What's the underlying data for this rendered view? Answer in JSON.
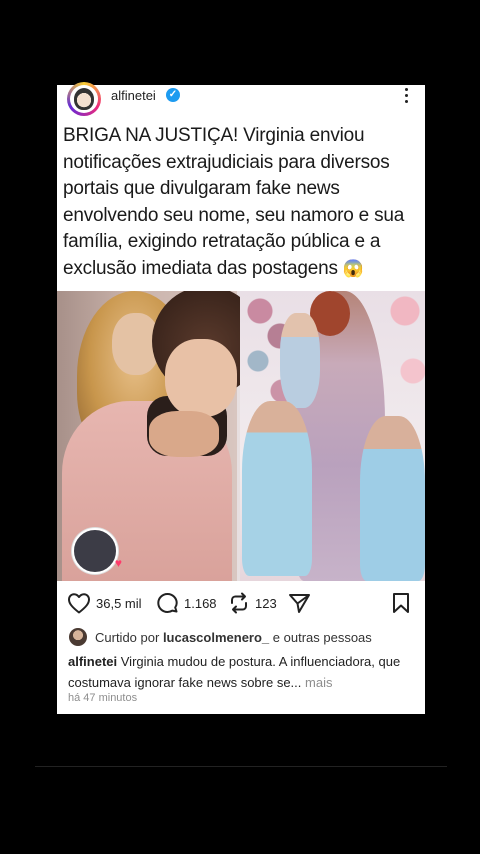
{
  "post": {
    "username": "alfinetei",
    "verified_mark": "✓",
    "headline_text": "BRIGA NA JUSTIÇA! Virginia enviou notificações extrajudiciais para diversos portais que divulgaram fake news envolvendo seu nome, seu namoro e sua família, exigindo retratação pública e a exclusão imediata das postagens",
    "headline_emoji": "😱",
    "actions": {
      "likes": "36,5 mil",
      "comments": "1.168",
      "reposts": "123"
    },
    "liked_by": {
      "prefix": "Curtido por",
      "user": "lucascolmenero_",
      "suffix": "e outras pessoas"
    },
    "caption": {
      "user": "alfinetei",
      "text": "Virginia mudou de postura. A influenciadora, que costumava ignorar fake news sobre se...",
      "more": "mais"
    },
    "time": "há 47 minutos"
  },
  "icons": {
    "like": "heart-icon",
    "comment": "comment-icon",
    "repost": "repost-icon",
    "share": "send-icon",
    "save": "bookmark-icon",
    "more": "more-options-icon"
  },
  "colors": {
    "background": "#000000",
    "card": "#ffffff",
    "verified": "#1d9bf0"
  }
}
